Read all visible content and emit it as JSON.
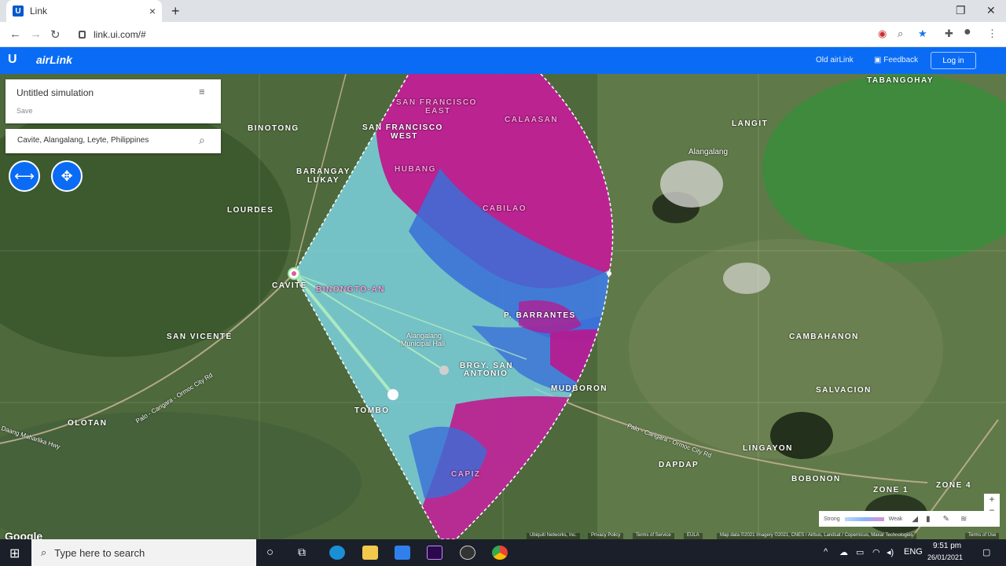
{
  "browser": {
    "tab_title": "Link",
    "favicon_letter": "U",
    "url": "link.ui.com/#",
    "new_tab": "+",
    "close_tab": "×"
  },
  "header": {
    "logo": "U",
    "brand": "airLink",
    "old_link": "Old airLink",
    "feedback": "Feedback",
    "login": "Log in"
  },
  "simulation": {
    "title": "Untitled simulation",
    "save": "Save",
    "search_value": "Cavite, Alangalang, Leyte, Philippines"
  },
  "places": [
    {
      "name": "BINOTONG",
      "style": "white"
    },
    {
      "name": "BARANGAY",
      "style": "white"
    },
    {
      "name": "LUKAY",
      "style": "white"
    },
    {
      "name": "LOURDES",
      "style": "white"
    },
    {
      "name": "CAVITE",
      "style": "white"
    },
    {
      "name": "SAN VICENTE",
      "style": "white"
    },
    {
      "name": "OLOTAN",
      "style": "white"
    },
    {
      "name": "TOMBO",
      "style": "white"
    },
    {
      "name": "SAN FRANCISCO",
      "style": "pink"
    },
    {
      "name": "EAST",
      "style": "pink"
    },
    {
      "name": "SAN FRANCISCO",
      "style": "white"
    },
    {
      "name": "WEST",
      "style": "white"
    },
    {
      "name": "CALAASAN",
      "style": "pink"
    },
    {
      "name": "HUBANG",
      "style": "pink"
    },
    {
      "name": "CABILAO",
      "style": "pink"
    },
    {
      "name": "BINONGTO-AN",
      "style": "pink"
    },
    {
      "name": "P. BARRANTES",
      "style": "white"
    },
    {
      "name": "Alangalang",
      "style": "white"
    },
    {
      "name": "Municipal Hall",
      "style": "white"
    },
    {
      "name": "BRGY. SAN",
      "style": "white"
    },
    {
      "name": "ANTONIO",
      "style": "white"
    },
    {
      "name": "MUDBORON",
      "style": "white"
    },
    {
      "name": "CAPIZ",
      "style": "pink"
    },
    {
      "name": "TABANGOHAY",
      "style": "white"
    },
    {
      "name": "LANGIT",
      "style": "white"
    },
    {
      "name": "Alangalang",
      "style": "white"
    },
    {
      "name": "CAMBAHANON",
      "style": "white"
    },
    {
      "name": "SALVACION",
      "style": "white"
    },
    {
      "name": "LINGAYON",
      "style": "white"
    },
    {
      "name": "DAPDAP",
      "style": "white"
    },
    {
      "name": "BOBONON",
      "style": "white"
    },
    {
      "name": "ZONE 4",
      "style": "white"
    },
    {
      "name": "ZONE 1",
      "style": "white"
    }
  ],
  "roads": [
    "Palo - Carigara - Ormoc City Rd",
    "Palo - Carigara - Ormoc City Rd",
    "Daang Maharlika Hwy"
  ],
  "legend": {
    "strong": "Strong",
    "weak": "Weak"
  },
  "attribution": [
    "Ubiquiti Networks, Inc.",
    "Privacy Policy",
    "Terms of Service",
    "EULA",
    "Map data ©2021 Imagery ©2021, CNES / Airbus, Landsat / Copernicus, Maxar Technologies",
    "Terms of Use"
  ],
  "google": "Google",
  "taskbar": {
    "search_placeholder": "Type here to search",
    "time": "9:51 pm",
    "date": "26/01/2021",
    "lang": "ENG"
  },
  "colors": {
    "brand": "#0a6cf5",
    "coverage_strong": "#7fd8e8",
    "coverage_mid": "#3a6fd8",
    "coverage_weak": "#c2128a"
  }
}
